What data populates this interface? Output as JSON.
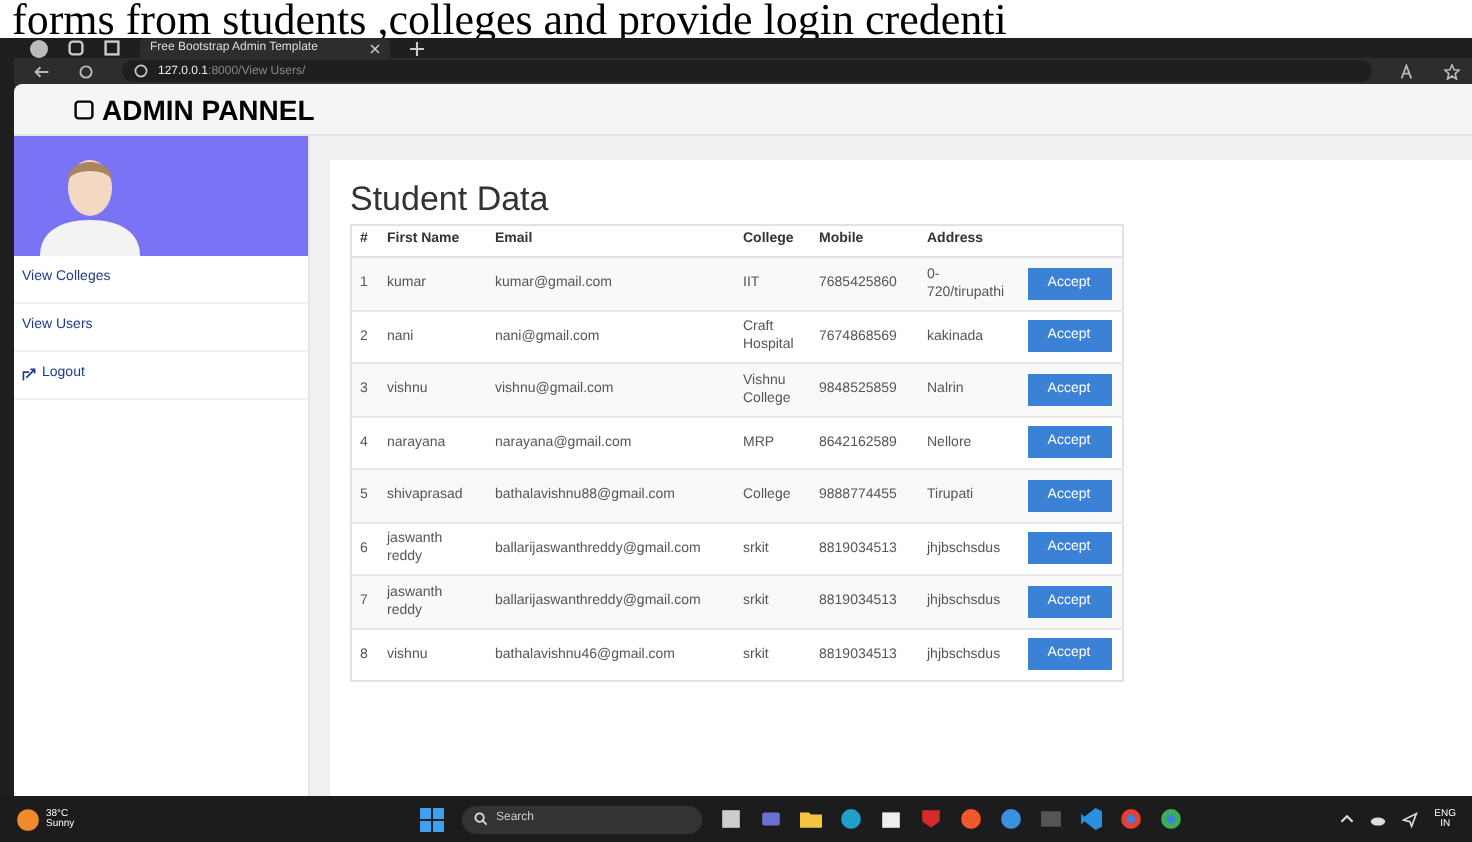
{
  "caption_fragment": "forms from students ,colleges and provide login credenti",
  "browser": {
    "tab_title": "Free Bootstrap Admin Template",
    "url_host": "127.0.0.1",
    "url_path": ":8000/View Users/"
  },
  "header": {
    "title": "ADMIN PANNEL"
  },
  "sidebar": {
    "items": [
      {
        "label": "View Colleges",
        "kind": "link"
      },
      {
        "label": "View Users",
        "kind": "link"
      },
      {
        "label": "Logout",
        "kind": "logout"
      }
    ]
  },
  "content": {
    "title": "Student Data",
    "table": {
      "columns": [
        "#",
        "First Name",
        "Email",
        "College",
        "Mobile",
        "Address"
      ],
      "rows": [
        {
          "cells": [
            "1",
            "kumar",
            "kumar@gmail.com",
            "IIT",
            "7685425860",
            "0-720/tirupathi"
          ],
          "action": "Accept"
        },
        {
          "cells": [
            "2",
            "nani",
            "nani@gmail.com",
            "Craft Hospital",
            "7674868569",
            "kakinada"
          ],
          "action": "Accept"
        },
        {
          "cells": [
            "3",
            "vishnu",
            "vishnu@gmail.com",
            "Vishnu College",
            "9848525859",
            "Nalrin"
          ],
          "action": "Accept"
        },
        {
          "cells": [
            "4",
            "narayana",
            "narayana@gmail.com",
            "MRP",
            "8642162589",
            "Nellore"
          ],
          "action": "Accept"
        },
        {
          "cells": [
            "5",
            "shivaprasad",
            "bathalavishnu88@gmail.com",
            "College",
            "9888774455",
            "Tirupati"
          ],
          "action": "Accept"
        },
        {
          "cells": [
            "6",
            "jaswanth reddy",
            "ballarijaswanthreddy@gmail.com",
            "srkit",
            "8819034513",
            "jhjbschsdus"
          ],
          "action": "Accept"
        },
        {
          "cells": [
            "7",
            "jaswanth reddy",
            "ballarijaswanthreddy@gmail.com",
            "srkit",
            "8819034513",
            "jhjbschsdus"
          ],
          "action": "Accept"
        },
        {
          "cells": [
            "8",
            "vishnu",
            "bathalavishnu46@gmail.com",
            "srkit",
            "8819034513",
            "jhjbschsdus"
          ],
          "action": "Accept"
        }
      ]
    }
  },
  "taskbar": {
    "weather_temp": "38°C",
    "weather_text": "Sunny",
    "search": "Search",
    "language": "ENG",
    "region": "IN"
  }
}
